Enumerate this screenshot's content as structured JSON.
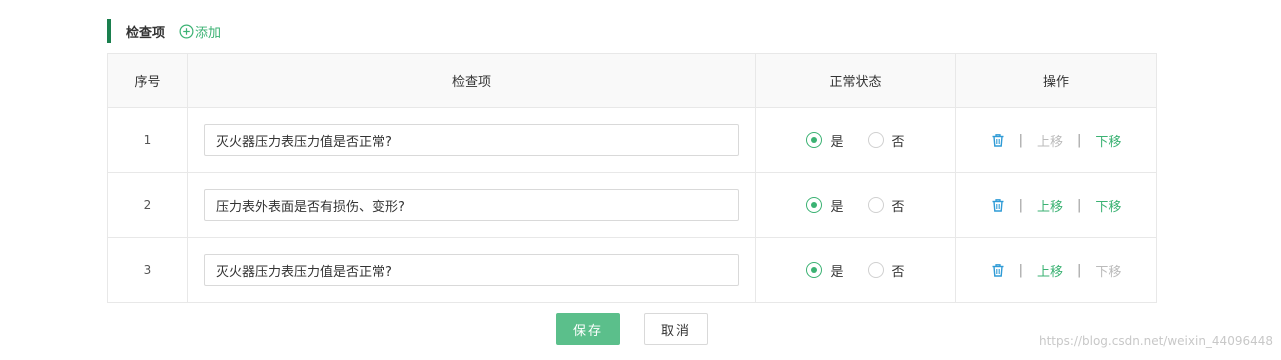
{
  "section": {
    "title": "检查项",
    "add_label": "添加"
  },
  "table": {
    "headers": [
      "序号",
      "检查项",
      "正常状态",
      "操作"
    ],
    "rows": [
      {
        "index": "1",
        "item": "灭火器压力表压力值是否正常?",
        "yes": "是",
        "no": "否",
        "selected": "yes",
        "move_up": "上移",
        "move_down": "下移",
        "up_enabled": false,
        "down_enabled": true
      },
      {
        "index": "2",
        "item": "压力表外表面是否有损伤、变形?",
        "yes": "是",
        "no": "否",
        "selected": "yes",
        "move_up": "上移",
        "move_down": "下移",
        "up_enabled": true,
        "down_enabled": true
      },
      {
        "index": "3",
        "item": "灭火器压力表压力值是否正常?",
        "yes": "是",
        "no": "否",
        "selected": "yes",
        "move_up": "上移",
        "move_down": "下移",
        "up_enabled": true,
        "down_enabled": false
      }
    ],
    "separator": "|"
  },
  "actions": {
    "save_label": "保存",
    "cancel_label": "取消"
  },
  "watermark": "https://blog.csdn.net/weixin_44096448",
  "colors": {
    "accent": "#3bb273",
    "save_button": "#5bbf8b",
    "section_bar": "#1a7f4e",
    "trash_icon": "#2f9bd6",
    "disabled": "#bbbbbb"
  },
  "icons": {
    "add": "plus-circle-icon",
    "delete": "trash-icon"
  }
}
